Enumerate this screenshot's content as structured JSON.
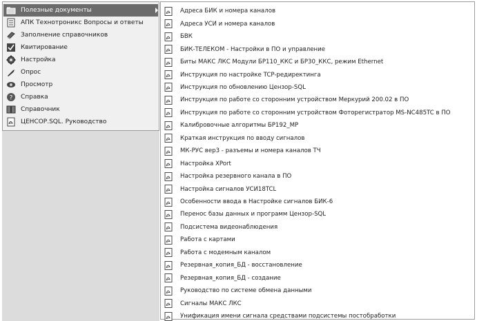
{
  "left_menu": {
    "items": [
      {
        "label": "Полезные документы",
        "icon": "folder-icon",
        "selected": true,
        "has_submenu": true
      },
      {
        "label": "АПК Технотроникс Вопросы и ответы",
        "icon": "document-icon"
      },
      {
        "label": "Заполнение справочников",
        "icon": "book-icon"
      },
      {
        "label": "Квитирование",
        "icon": "check-icon"
      },
      {
        "label": "Настройка",
        "icon": "gear-icon"
      },
      {
        "label": "Опрос",
        "icon": "wrench-icon"
      },
      {
        "label": "Просмотр",
        "icon": "eye-icon"
      },
      {
        "label": "Справка",
        "icon": "help-icon"
      },
      {
        "label": "Справочник",
        "icon": "reference-book-icon"
      },
      {
        "label": "ЦЕНСОР.SQL. Руководство",
        "icon": "pdf-icon"
      }
    ]
  },
  "submenu": {
    "items": [
      "Адреса БИК и номера каналов",
      "Адреса УСИ и номера каналов",
      "БВК",
      "БИК-ТЕЛЕКОМ - Настройки в ПО и управление",
      "Биты МАКС ЛКС Модули БР110_ККС и БР30_ККС, режим Ethernet",
      "Инструкция по настройке TCP-редиректинга",
      "Инструкция по обновлению Цензор-SQL",
      "Инструкция по работе со сторонним устройством Меркурий 200.02 в ПО",
      "Инструкция по работе со сторонним устройством Фоторегистратор MS-NC485TC в ПО",
      "Калибровочные алгоритмы БР192_МР",
      "Краткая инструкция по вводу сигналов",
      "МК-РУС вер3 - разъемы и номера каналов ТЧ",
      "Настройка XPort",
      "Настройка резервного канала в ПО",
      "Настройка сигналов УСИ18TCL",
      "Особенности ввода в Настройке сигналов БИК-6",
      "Перенос базы данных и программ Цензор-SQL",
      "Подсистема видеонаблюдения",
      "Работа с картами",
      "Работа с модемным каналом",
      "Резервная_копия_БД - восстановление",
      "Резервная_копия_БД - создание",
      "Руководство по системе обмена данными",
      "Сигналы МАКС ЛКС",
      "Унификация имени сигнала средствами подсистемы постобработки"
    ],
    "item_icon": "pdf-document-icon"
  },
  "colors": {
    "selected_bg": "#6b6b6b",
    "menu_bg": "#f0f0f0",
    "empty_area_bg": "#dcdcdc"
  }
}
